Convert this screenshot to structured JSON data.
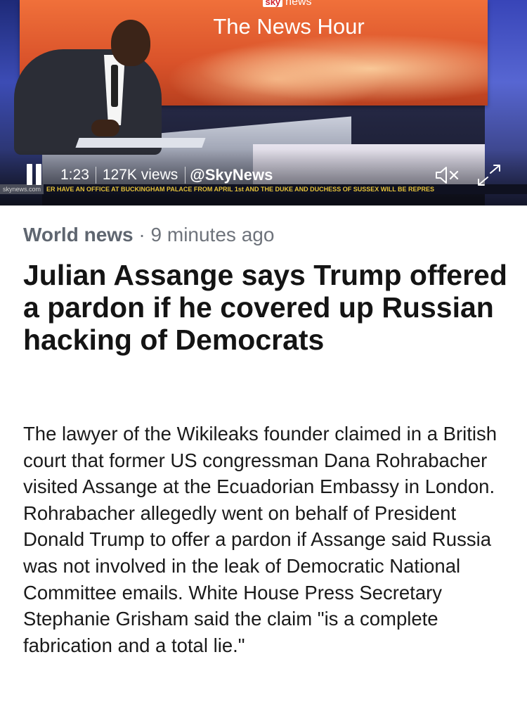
{
  "video": {
    "channel_logo_brand": "sky",
    "channel_logo_text": "news",
    "show_title": "The News Hour",
    "ticker_site": "skynews.com",
    "ticker_text": "ER HAVE AN OFFICE AT BUCKINGHAM PALACE FROM APRIL 1st AND THE DUKE AND DUCHESS OF SUSSEX WILL BE REPRES",
    "elapsed_time": "1:23",
    "view_count": "127K views",
    "source_handle": "@SkyNews",
    "icons": [
      "pause-icon",
      "muted-speaker-icon",
      "fullscreen-expand-icon"
    ]
  },
  "article": {
    "category": "World news",
    "separator": "·",
    "timestamp": "9 minutes ago",
    "headline": "Julian Assange says Trump offered a pardon if he covered up Russian hacking of Democrats",
    "body": "The lawyer of the Wikileaks founder claimed in a British court that former US congressman Dana Rohrabacher visited Assange at the Ecuadorian Embassy in London. Rohrabacher allegedly went on behalf of President Donald Trump to offer a pardon if Assange said Russia was not involved in the leak of Democratic National Committee emails. White House Press Secretary Stephanie Grisham said the claim \"is a complete fabrication and a total lie.\""
  },
  "colors": {
    "headline_text": "#141414",
    "meta_text": "#6e737b",
    "brand_red": "#d2232a",
    "ticker_yellow": "#e5c23a"
  }
}
